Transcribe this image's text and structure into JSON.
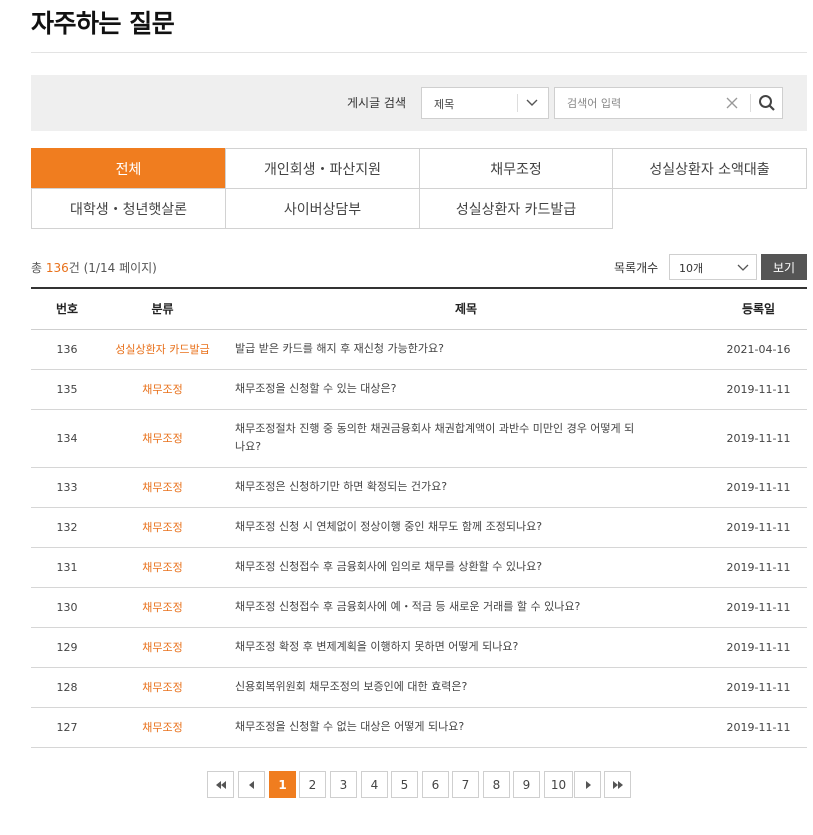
{
  "page": {
    "title": "자주하는 질문"
  },
  "search": {
    "label": "게시글 검색",
    "field_value": "제목",
    "placeholder": "검색어 입력"
  },
  "tabs": [
    {
      "label": "전체",
      "active": true
    },
    {
      "label": "개인회생・파산지원",
      "active": false
    },
    {
      "label": "채무조정",
      "active": false
    },
    {
      "label": "성실상환자 소액대출",
      "active": false
    },
    {
      "label": "대학생・청년햇살론",
      "active": false
    },
    {
      "label": "사이버상담부",
      "active": false
    },
    {
      "label": "성실상환자 카드발급",
      "active": false
    }
  ],
  "summary": {
    "prefix": "총 ",
    "total": "136",
    "suffix": "건 (1/14 페이지)",
    "per_page_label": "목록개수",
    "per_page_value": "10개",
    "view_label": "보기"
  },
  "table": {
    "headers": {
      "no": "번호",
      "category": "분류",
      "subject": "제목",
      "date": "등록일"
    },
    "rows": [
      {
        "no": "136",
        "category": "성실상환자 카드발급",
        "subject": "발급 받은 카드를 해지 후 재신청 가능한가요?",
        "date": "2021-04-16"
      },
      {
        "no": "135",
        "category": "채무조정",
        "subject": "채무조정을 신청할 수 있는 대상은?",
        "date": "2019-11-11"
      },
      {
        "no": "134",
        "category": "채무조정",
        "subject": "채무조정절차 진행 중 동의한 채권금융회사 채권합계액이 과반수 미만인 경우 어떻게 되나요?",
        "date": "2019-11-11"
      },
      {
        "no": "133",
        "category": "채무조정",
        "subject": "채무조정은 신청하기만 하면 확정되는 건가요?",
        "date": "2019-11-11"
      },
      {
        "no": "132",
        "category": "채무조정",
        "subject": "채무조정 신청 시 연체없이 정상이행 중인 채무도 함께 조정되나요?",
        "date": "2019-11-11"
      },
      {
        "no": "131",
        "category": "채무조정",
        "subject": "채무조정 신청접수 후 금융회사에 임의로 채무를 상환할 수 있나요?",
        "date": "2019-11-11"
      },
      {
        "no": "130",
        "category": "채무조정",
        "subject": "채무조정 신청접수 후 금융회사에 예・적금 등 새로운 거래를 할 수 있나요?",
        "date": "2019-11-11"
      },
      {
        "no": "129",
        "category": "채무조정",
        "subject": "채무조정 확정 후 변제계획을 이행하지 못하면 어떻게 되나요?",
        "date": "2019-11-11"
      },
      {
        "no": "128",
        "category": "채무조정",
        "subject": "신용회복위원회 채무조정의 보증인에 대한 효력은?",
        "date": "2019-11-11"
      },
      {
        "no": "127",
        "category": "채무조정",
        "subject": "채무조정을 신청할 수 없는 대상은 어떻게 되나요?",
        "date": "2019-11-11"
      }
    ]
  },
  "pagination": {
    "pages": [
      "1",
      "2",
      "3",
      "4",
      "5",
      "6",
      "7",
      "8",
      "9",
      "10"
    ],
    "current": "1",
    "icons": [
      "first-page-icon",
      "prev-page-icon",
      "next-page-icon",
      "last-page-icon"
    ]
  },
  "colors": {
    "accent": "#f07d1f",
    "category_text": "#e8711b",
    "view_button": "#555555"
  }
}
